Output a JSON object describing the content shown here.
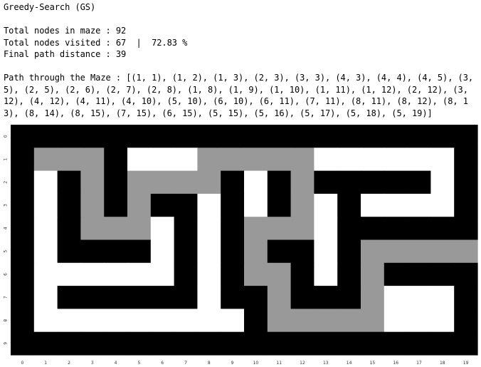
{
  "output": {
    "algorithm_title": "Greedy-Search (GS)",
    "total_nodes_line": "Total nodes in maze : 92",
    "visited_line": "Total nodes visited : 67  |  72.83 %",
    "distance_line": "Final path distance : 39",
    "path_line": "Path through the Maze : [(1, 1), (1, 2), (1, 3), (2, 3), (3, 3), (4, 3), (4, 4), (4, 5), (3, 5), (2, 5), (2, 6), (2, 7), (2, 8), (1, 8), (1, 9), (1, 10), (1, 11), (1, 12), (2, 12), (3, 12), (4, 12), (4, 11), (4, 10), (5, 10), (6, 10), (6, 11), (7, 11), (8, 11), (8, 12), (8, 13), (8, 14), (8, 15), (7, 15), (6, 15), (5, 15), (5, 16), (5, 17), (5, 18), (5, 19)]"
  },
  "maze": {
    "legend": {
      "0": "wall",
      "1": "open",
      "2": "path"
    },
    "colors": {
      "wall": "#000000",
      "open": "#ffffff",
      "path": "#999999",
      "tick": "#333333"
    },
    "x_ticks": [
      "0",
      "1",
      "2",
      "3",
      "4",
      "5",
      "6",
      "7",
      "8",
      "9",
      "10",
      "11",
      "12",
      "13",
      "14",
      "15",
      "16",
      "17",
      "18",
      "19"
    ],
    "y_ticks": [
      "0",
      "1",
      "2",
      "3",
      "4",
      "5",
      "6",
      "7",
      "8",
      "9"
    ],
    "grid": [
      [
        0,
        0,
        0,
        0,
        0,
        0,
        0,
        0,
        0,
        0,
        0,
        0,
        0,
        0,
        0,
        0,
        0,
        0,
        0,
        0
      ],
      [
        0,
        2,
        2,
        2,
        0,
        1,
        1,
        1,
        2,
        2,
        2,
        2,
        2,
        1,
        1,
        1,
        1,
        1,
        1,
        0
      ],
      [
        0,
        1,
        0,
        2,
        0,
        2,
        2,
        2,
        2,
        0,
        1,
        0,
        2,
        0,
        0,
        0,
        0,
        0,
        1,
        0
      ],
      [
        0,
        1,
        0,
        2,
        0,
        2,
        0,
        0,
        1,
        0,
        1,
        0,
        2,
        1,
        0,
        1,
        1,
        1,
        1,
        0
      ],
      [
        0,
        1,
        0,
        2,
        2,
        2,
        1,
        0,
        1,
        0,
        2,
        2,
        2,
        1,
        0,
        0,
        0,
        0,
        0,
        0
      ],
      [
        0,
        1,
        0,
        0,
        0,
        0,
        1,
        0,
        1,
        0,
        2,
        0,
        0,
        1,
        0,
        2,
        2,
        2,
        2,
        2
      ],
      [
        0,
        1,
        1,
        1,
        1,
        1,
        1,
        0,
        1,
        0,
        2,
        2,
        0,
        1,
        0,
        2,
        0,
        0,
        0,
        0
      ],
      [
        0,
        1,
        0,
        0,
        0,
        0,
        0,
        0,
        1,
        0,
        0,
        2,
        0,
        0,
        0,
        2,
        1,
        1,
        1,
        0
      ],
      [
        0,
        1,
        1,
        1,
        1,
        1,
        1,
        1,
        1,
        1,
        0,
        2,
        2,
        2,
        2,
        2,
        1,
        1,
        1,
        0
      ],
      [
        0,
        0,
        0,
        0,
        0,
        0,
        0,
        0,
        0,
        0,
        0,
        0,
        0,
        0,
        0,
        0,
        0,
        0,
        0,
        0
      ]
    ]
  }
}
